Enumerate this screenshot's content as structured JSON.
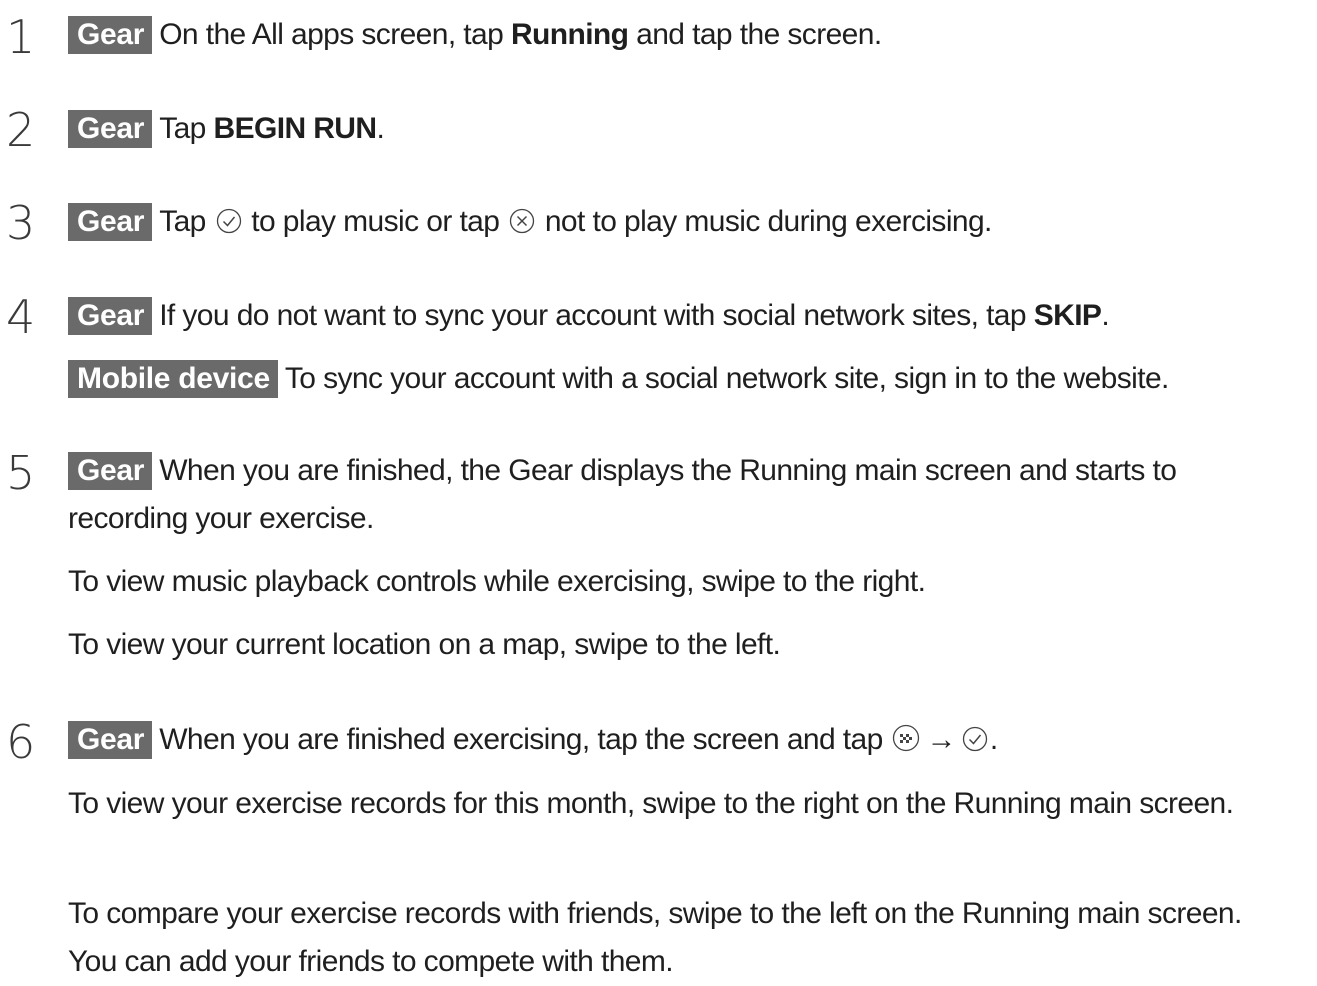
{
  "steps": [
    {
      "number": "1",
      "tag": "Gear",
      "text_a": "On the All apps screen, tap ",
      "bold": "Running",
      "text_b": " and tap the screen."
    },
    {
      "number": "2",
      "tag": "Gear",
      "text_a": "Tap ",
      "bold": "BEGIN RUN",
      "text_b": "."
    },
    {
      "number": "3",
      "tag": "Gear",
      "text_a": "Tap ",
      "text_b": " to play music or tap ",
      "text_c": " not to play music during exercising."
    },
    {
      "number": "4",
      "tag": "Gear",
      "text_a": "If you do not want to sync your account with social network sites, tap ",
      "bold": "SKIP",
      "text_b": ".",
      "sub_tag": "Mobile device",
      "sub_text": "To sync your account with a social network site, sign in to the website."
    },
    {
      "number": "5",
      "tag": "Gear",
      "text_a": "When you are finished, the Gear displays the Running main screen and starts to recording your exercise.",
      "note_1": "To view music playback controls while exercising, swipe to the right.",
      "note_2": "To view your current location on a map, swipe to the left."
    },
    {
      "number": "6",
      "tag": "Gear",
      "text_a": "When you are finished exercising, tap the screen and tap ",
      "arrow": "→",
      "text_b": ".",
      "note_1": "To view your exercise records for this month, swipe to the right on the Running main screen.",
      "note_2": "To compare your exercise records with friends, swipe to the left on the Running main screen. You can add your friends to compete with them."
    }
  ],
  "icons": {
    "check": "check-circle-icon",
    "cancel": "cancel-circle-icon",
    "finish": "finish-flag-icon"
  },
  "colors": {
    "tag_background": "#6a6a6a",
    "tag_text": "#ffffff",
    "body_text": "#1f1f1f"
  }
}
